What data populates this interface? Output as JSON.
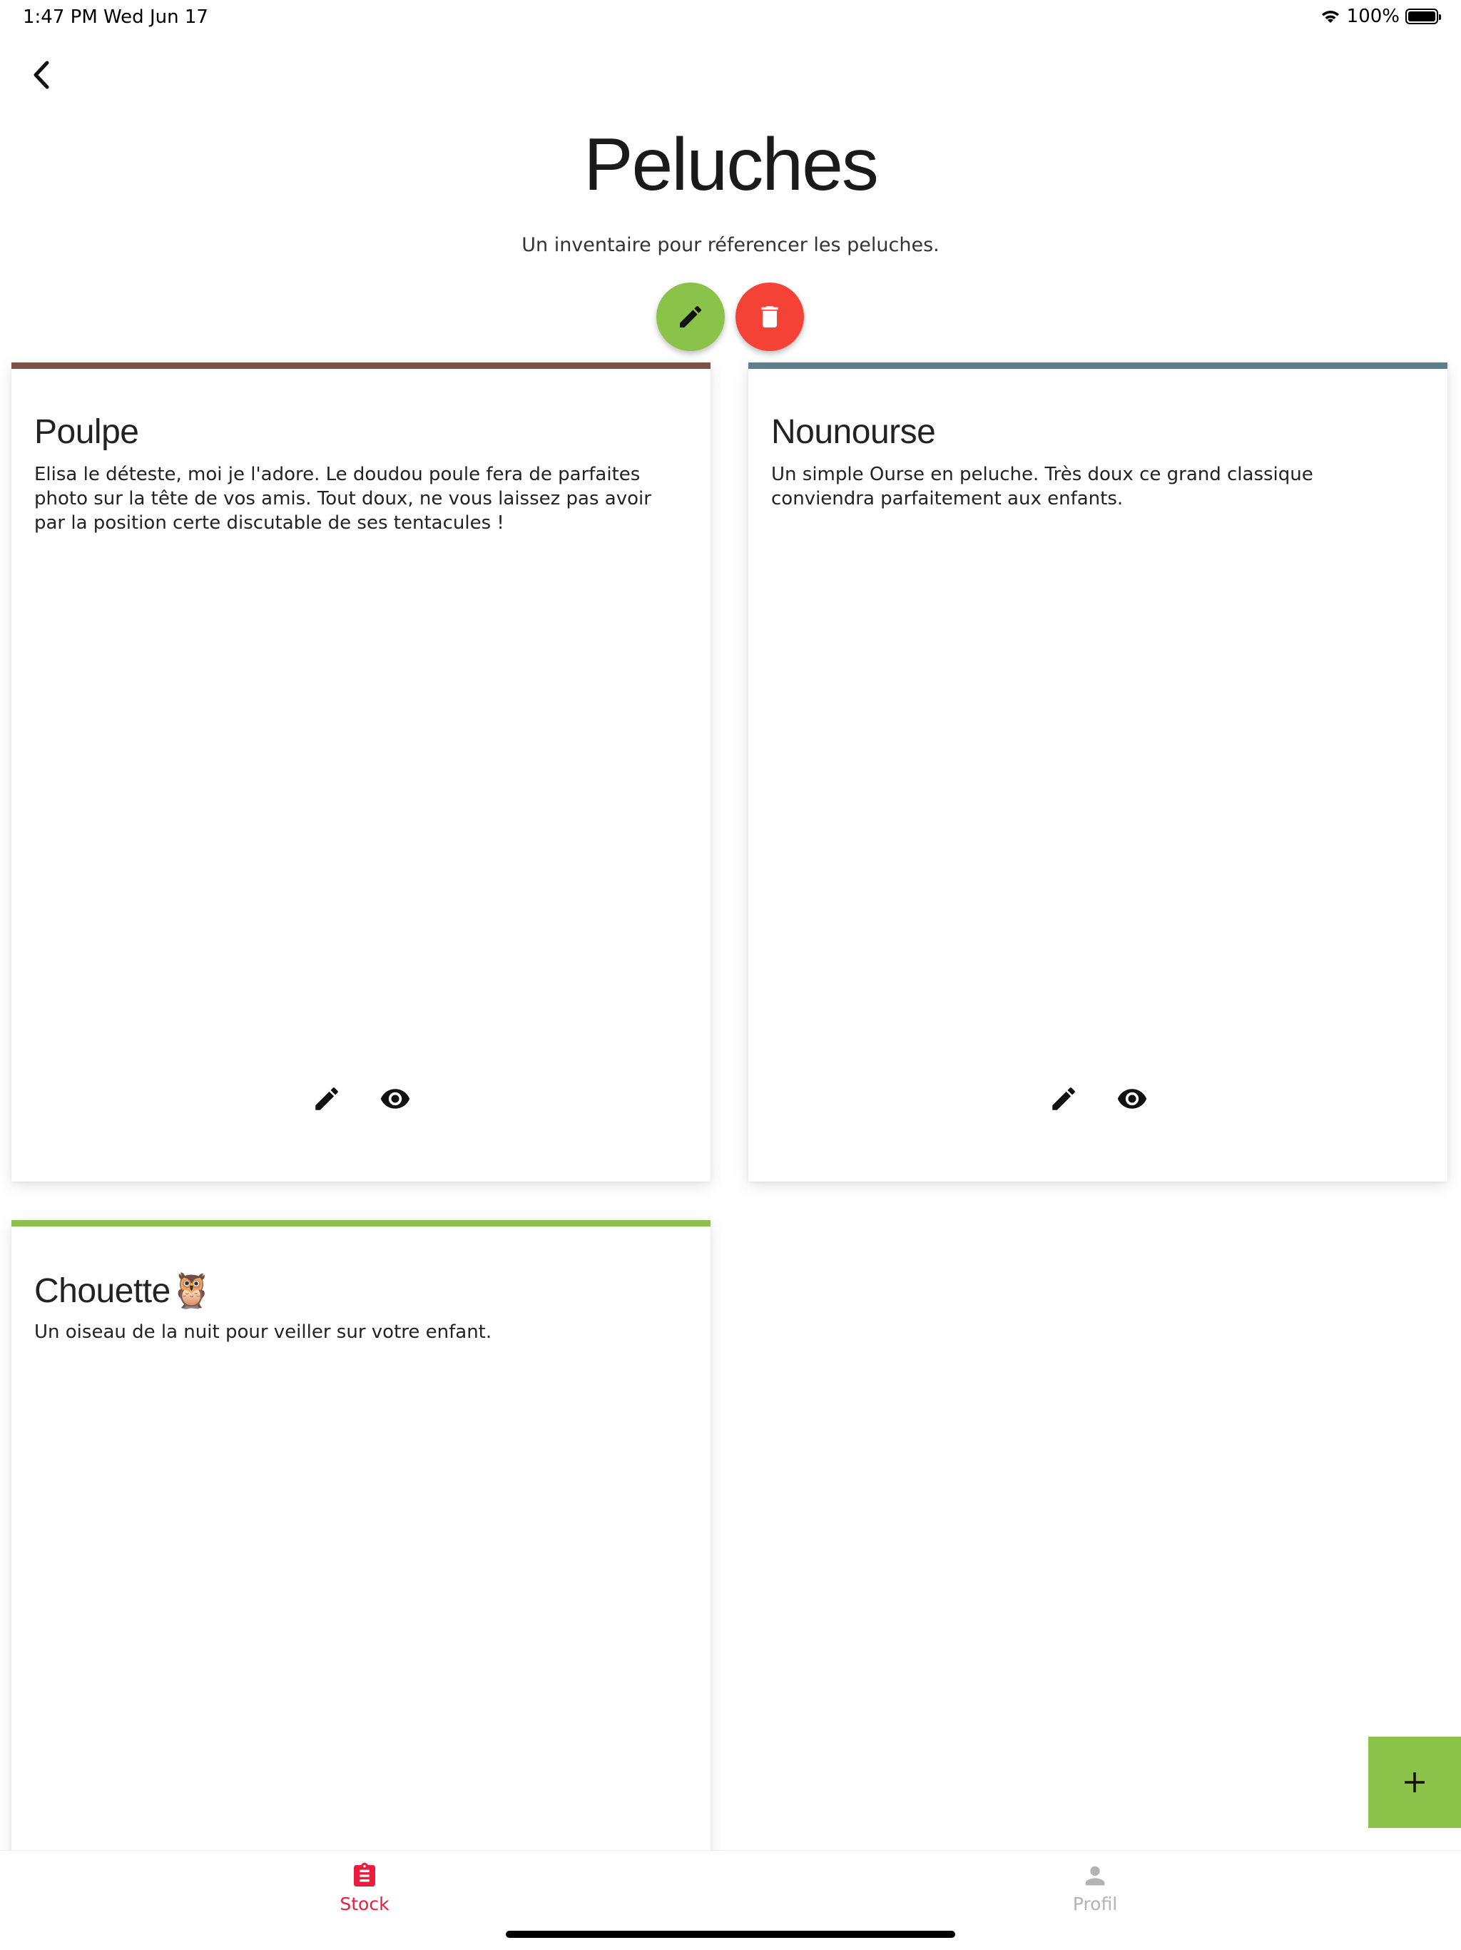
{
  "status_bar": {
    "time": "1:47 PM",
    "date": "Wed Jun 17",
    "battery": "100%"
  },
  "header": {
    "title": "Peluches",
    "subtitle": "Un inventaire pour réferencer les peluches."
  },
  "colors": {
    "green": "#8bc34a",
    "red": "#f44336",
    "accent": "#e91e3f",
    "brown": "#795548",
    "slate": "#607d8b"
  },
  "cards": [
    {
      "title": "Poulpe",
      "description": "Elisa le déteste, moi je l'adore. Le doudou poule fera de parfaites photo sur la tête de vos amis. Tout doux, ne vous laissez pas avoir par la position certe discutable de ses tentacules !",
      "color": "#795548"
    },
    {
      "title": "Nounourse",
      "description": "Un simple Ourse en peluche. Très doux ce grand classique conviendra parfaitement aux enfants.",
      "color": "#607d8b"
    },
    {
      "title": "Chouette🦉",
      "description": "Un oiseau de la nuit pour veiller sur votre enfant.",
      "color": "#8bc34a"
    }
  ],
  "tabs": [
    {
      "label": "Stock",
      "icon": "clipboard-icon",
      "active": true
    },
    {
      "label": "Profil",
      "icon": "person-icon",
      "active": false
    }
  ]
}
